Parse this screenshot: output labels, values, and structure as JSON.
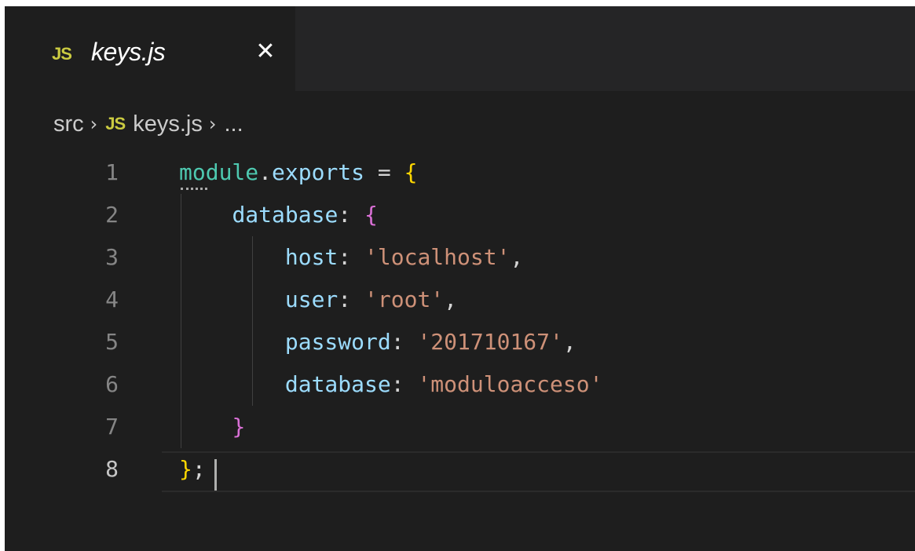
{
  "tab": {
    "icon": "JS",
    "label": "keys.js",
    "close": "✕"
  },
  "breadcrumb": {
    "folder": "src",
    "separator": "›",
    "file_icon": "JS",
    "file": "keys.js",
    "rest": "..."
  },
  "editor": {
    "line_numbers": [
      "1",
      "2",
      "3",
      "4",
      "5",
      "6",
      "7",
      "8"
    ],
    "line1": {
      "module": "module",
      "dot": ".",
      "exports": "exports",
      "eq": " = ",
      "brace": "{"
    },
    "line2": {
      "indent": "    ",
      "key": "database",
      "colon": ": ",
      "brace": "{"
    },
    "line3": {
      "indent": "        ",
      "key": "host",
      "colon": ": ",
      "value": "'localhost'",
      "comma": ","
    },
    "line4": {
      "indent": "        ",
      "key": "user",
      "colon": ": ",
      "value": "'root'",
      "comma": ","
    },
    "line5": {
      "indent": "        ",
      "key": "password",
      "colon": ": ",
      "value": "'201710167'",
      "comma": ","
    },
    "line6": {
      "indent": "        ",
      "key": "database",
      "colon": ": ",
      "value": "'moduloacceso'"
    },
    "line7": {
      "indent": "    ",
      "brace": "}"
    },
    "line8": {
      "brace": "}",
      "semi": ";"
    }
  },
  "colors": {
    "background": "#1e1e1e",
    "tab_strip": "#252526",
    "js_icon": "#cbcb41",
    "property": "#9cdcfe",
    "module": "#4ec9b0",
    "string": "#ce9178",
    "bracket_level1": "#ffd700",
    "bracket_level2": "#da70d6"
  }
}
